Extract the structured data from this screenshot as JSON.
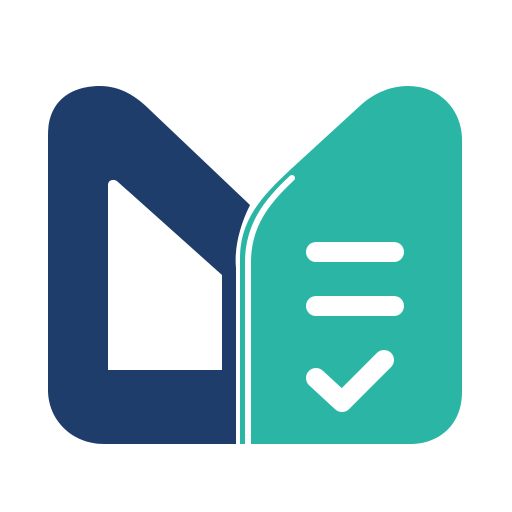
{
  "logo": {
    "icon": "m-document-check-logo",
    "colors": {
      "background": "#ffffff",
      "navy": "#1f3d6b",
      "teal": "#2bb5a4",
      "line": "#ffffff"
    }
  }
}
